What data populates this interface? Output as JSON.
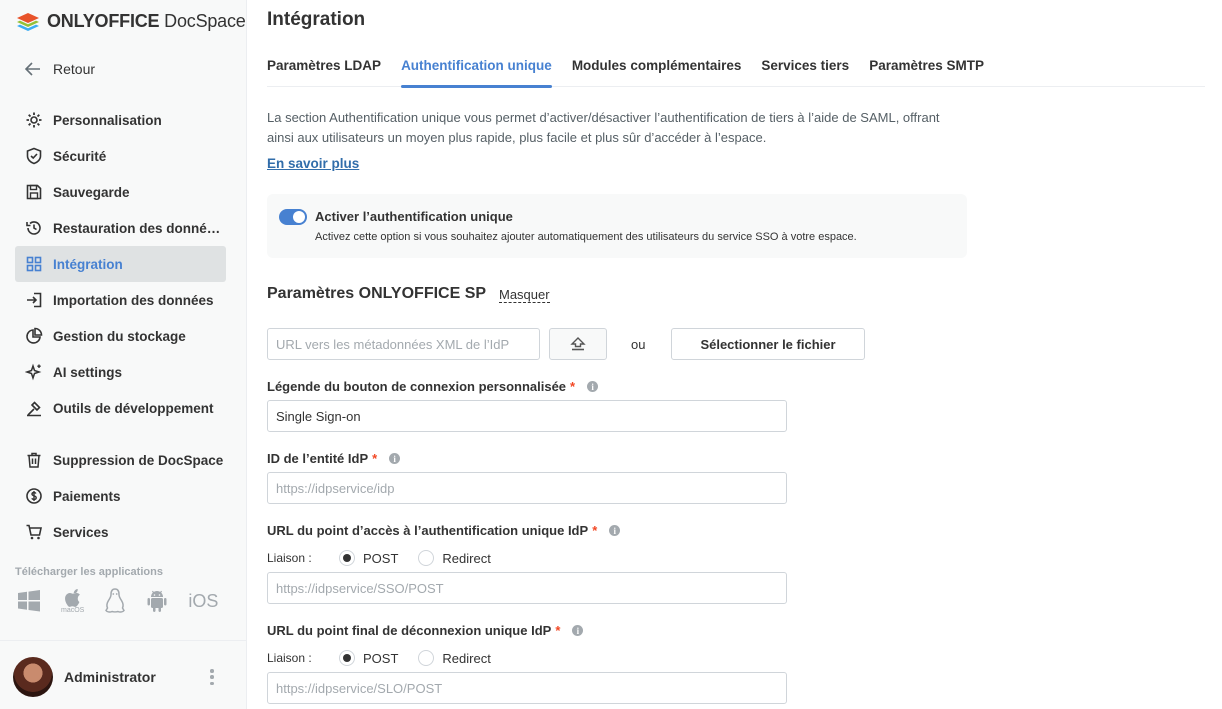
{
  "app": {
    "brand_bold": "ONLYOFFICE",
    "brand_regular": " DocSpace"
  },
  "sidebar": {
    "back_label": "Retour",
    "items": [
      {
        "label": "Personnalisation",
        "icon": "gear-icon"
      },
      {
        "label": "Sécurité",
        "icon": "shield-icon"
      },
      {
        "label": "Sauvegarde",
        "icon": "save-icon"
      },
      {
        "label": "Restauration des donné…",
        "icon": "restore-icon"
      },
      {
        "label": "Intégration",
        "icon": "grid-icon",
        "active": true
      },
      {
        "label": "Importation des données",
        "icon": "import-icon"
      },
      {
        "label": "Gestion du stockage",
        "icon": "pie-icon"
      },
      {
        "label": "AI settings",
        "icon": "sparkle-icon"
      },
      {
        "label": "Outils de développement",
        "icon": "dev-tools-icon"
      },
      {
        "label": "Suppression de DocSpace",
        "icon": "trash-icon"
      },
      {
        "label": "Paiements",
        "icon": "dollar-icon"
      },
      {
        "label": "Services",
        "icon": "cart-icon"
      }
    ],
    "apps_label": "Télécharger les applications",
    "apps": [
      "windows-icon",
      "macos-icon",
      "linux-icon",
      "android-icon",
      "ios-icon"
    ],
    "macos_label": "macOS",
    "ios_label": "iOS",
    "user_name": "Administrator"
  },
  "main": {
    "title": "Intégration",
    "tabs": [
      {
        "label": "Paramètres LDAP"
      },
      {
        "label": "Authentification unique",
        "active": true
      },
      {
        "label": "Modules complémentaires"
      },
      {
        "label": "Services tiers"
      },
      {
        "label": "Paramètres SMTP"
      }
    ],
    "description": "La section Authentification unique vous permet d’activer/désactiver l’authentification de tiers à l’aide de SAML, offrant ainsi aux utilisateurs un moyen plus rapide, plus facile et plus sûr d’accéder à l’espace.",
    "learn_more": "En savoir plus",
    "toggle": {
      "on": true,
      "title": "Activer l’authentification unique",
      "subtitle": "Activez cette option si vous souhaitez ajouter automatiquement des utilisateurs du service SSO à votre espace."
    },
    "sp_section": {
      "title": "Paramètres ONLYOFFICE SP",
      "hide_link": "Masquer",
      "metadata_placeholder": "URL vers les métadonnées XML de l’IdP",
      "or_label": "ou",
      "select_file": "Sélectionner le fichier"
    },
    "fields": {
      "button_caption": {
        "label": "Légende du bouton de connexion personnalisée",
        "value": "Single Sign-on"
      },
      "entity_id": {
        "label": "ID de l’entité IdP",
        "placeholder": "https://idpservice/idp"
      },
      "sso_url": {
        "label": "URL du point d’accès à l’authentification unique IdP",
        "binding_label": "Liaison :",
        "opt1": "POST",
        "opt2": "Redirect",
        "selected": "POST",
        "placeholder": "https://idpservice/SSO/POST"
      },
      "slo_url": {
        "label": "URL du point final de déconnexion unique IdP",
        "binding_label": "Liaison :",
        "opt1": "POST",
        "opt2": "Redirect",
        "selected": "POST",
        "placeholder": "https://idpservice/SLO/POST"
      }
    },
    "required_mark": "*",
    "info_glyph": "i"
  }
}
